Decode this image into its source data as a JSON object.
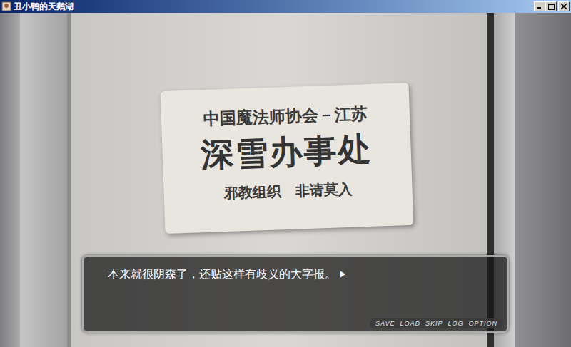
{
  "window": {
    "title": "丑小鸭的天鹅湖"
  },
  "sign": {
    "lines": [
      "中国魔法师协会－江苏",
      "深雪办事处",
      "邪教组织　非请莫入"
    ]
  },
  "dialog": {
    "text": "本来就很阴森了，还贴这样有歧义的大字报。",
    "advance": "▶"
  },
  "menu": [
    {
      "label": "SAVE"
    },
    {
      "label": "LOAD"
    },
    {
      "label": "SKIP"
    },
    {
      "label": "LOG"
    },
    {
      "label": "OPTION"
    }
  ]
}
